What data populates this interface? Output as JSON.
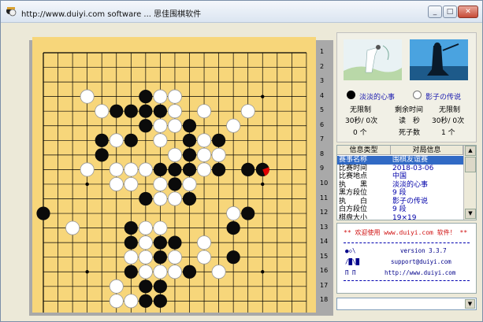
{
  "window": {
    "title": "http://www.duiyi.com software ... 思佳围棋软件",
    "buttons": {
      "minimize": "_",
      "maximize": "□",
      "close": "✕"
    },
    "accent": "#316ac5"
  },
  "board": {
    "size": 19,
    "background": "#f7d67a",
    "row_numbers": [
      "1",
      "2",
      "3",
      "4",
      "5",
      "6",
      "7",
      "8",
      "9",
      "10",
      "11",
      "12",
      "13",
      "14",
      "15",
      "16",
      "17",
      "18"
    ],
    "black_stones": [
      [
        8,
        4
      ],
      [
        6,
        5
      ],
      [
        7,
        5
      ],
      [
        8,
        5
      ],
      [
        9,
        5
      ],
      [
        8,
        6
      ],
      [
        11,
        6
      ],
      [
        5,
        7
      ],
      [
        7,
        7
      ],
      [
        11,
        7
      ],
      [
        13,
        7
      ],
      [
        5,
        8
      ],
      [
        10,
        8
      ],
      [
        11,
        8
      ],
      [
        9,
        9
      ],
      [
        10,
        9
      ],
      [
        11,
        9
      ],
      [
        13,
        9
      ],
      [
        15,
        9
      ],
      [
        16,
        9
      ],
      [
        10,
        10
      ],
      [
        8,
        11
      ],
      [
        10,
        11
      ],
      [
        11,
        11
      ],
      [
        1,
        12
      ],
      [
        15,
        12
      ],
      [
        7,
        13
      ],
      [
        14,
        13
      ],
      [
        7,
        14
      ],
      [
        9,
        14
      ],
      [
        10,
        14
      ],
      [
        7,
        15
      ],
      [
        9,
        15
      ],
      [
        14,
        15
      ],
      [
        7,
        16
      ],
      [
        9,
        16
      ],
      [
        11,
        16
      ],
      [
        8,
        17
      ],
      [
        9,
        17
      ],
      [
        8,
        18
      ],
      [
        9,
        18
      ]
    ],
    "white_stones": [
      [
        4,
        4
      ],
      [
        9,
        4
      ],
      [
        10,
        4
      ],
      [
        5,
        5
      ],
      [
        10,
        5
      ],
      [
        12,
        5
      ],
      [
        15,
        5
      ],
      [
        9,
        6
      ],
      [
        10,
        6
      ],
      [
        14,
        6
      ],
      [
        6,
        7
      ],
      [
        9,
        7
      ],
      [
        12,
        7
      ],
      [
        10,
        8
      ],
      [
        12,
        8
      ],
      [
        13,
        8
      ],
      [
        6,
        9
      ],
      [
        7,
        9
      ],
      [
        8,
        9
      ],
      [
        4,
        9
      ],
      [
        12,
        9
      ],
      [
        6,
        10
      ],
      [
        7,
        10
      ],
      [
        9,
        10
      ],
      [
        11,
        10
      ],
      [
        9,
        11
      ],
      [
        10,
        11
      ],
      [
        14,
        12
      ],
      [
        3,
        13
      ],
      [
        8,
        13
      ],
      [
        9,
        13
      ],
      [
        8,
        14
      ],
      [
        12,
        14
      ],
      [
        8,
        15
      ],
      [
        10,
        15
      ],
      [
        7,
        15
      ],
      [
        12,
        15
      ],
      [
        13,
        16
      ],
      [
        6,
        17
      ],
      [
        8,
        16
      ],
      [
        10,
        16
      ],
      [
        9,
        16
      ],
      [
        6,
        18
      ],
      [
        7,
        18
      ]
    ],
    "last_move": [
      16,
      9
    ]
  },
  "players": {
    "black": {
      "name": "淡淡的心事",
      "time_label": "无限制",
      "byoyomi": "30秒/ 0次",
      "captures": "0 个"
    },
    "white": {
      "name": "影子の传说",
      "time_label": "无限制",
      "byoyomi": "30秒/ 0次",
      "captures": "1 个"
    },
    "center": {
      "remaining_label": "剩余时间",
      "read_label": "读　秒",
      "captures_label": "死子数"
    }
  },
  "info_table": {
    "headers": [
      "信息类型",
      "对局信息"
    ],
    "rows": [
      {
        "key": "赛事名称",
        "value": "围棋友谊赛"
      },
      {
        "key": "比赛时间",
        "value": "2018-03-06"
      },
      {
        "key": "比赛地点",
        "value": "中国"
      },
      {
        "key": "执　　黑",
        "value": "淡淡的心事"
      },
      {
        "key": "黑方段位",
        "value": "9 段"
      },
      {
        "key": "执　　白",
        "value": "影子の传说"
      },
      {
        "key": "白方段位",
        "value": "9 段"
      },
      {
        "key": "棋盘大小",
        "value": "19×19"
      }
    ]
  },
  "message": {
    "welcome": "** 欢迎使用 www.duiyi.com 软件！ **",
    "logo_line1": "●◇\\",
    "logo_line2": "/█\\█",
    "logo_line3": "Π Π",
    "version": "version 3.3.7",
    "email": "support@duiyi.com",
    "url": "http://www.duiyi.com"
  },
  "dropdown": {
    "value": ""
  }
}
